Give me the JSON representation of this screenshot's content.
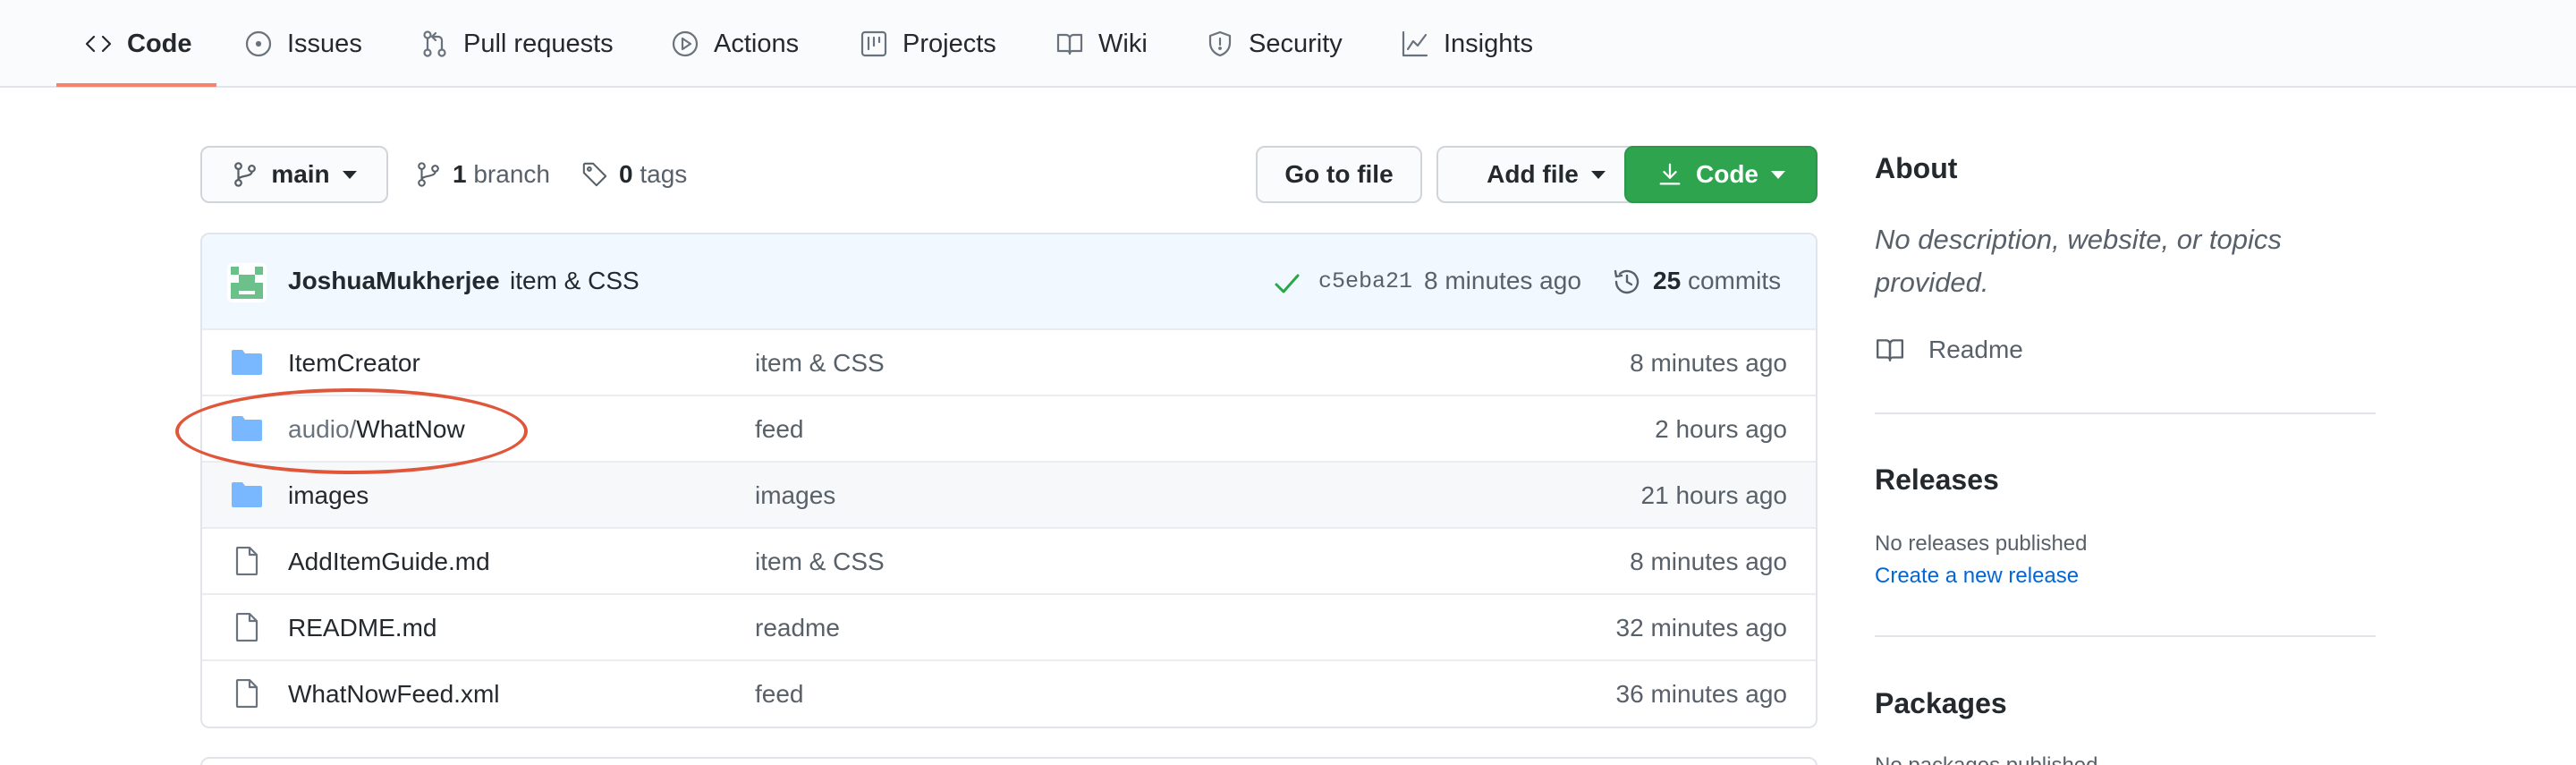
{
  "nav": {
    "tabs": [
      {
        "label": "Code",
        "icon": "code-icon",
        "selected": true
      },
      {
        "label": "Issues",
        "icon": "issue-opened-icon"
      },
      {
        "label": "Pull requests",
        "icon": "git-pull-request-icon"
      },
      {
        "label": "Actions",
        "icon": "play-icon"
      },
      {
        "label": "Projects",
        "icon": "project-icon"
      },
      {
        "label": "Wiki",
        "icon": "book-icon"
      },
      {
        "label": "Security",
        "icon": "shield-icon"
      },
      {
        "label": "Insights",
        "icon": "graph-icon"
      }
    ],
    "accent_color": "#f9826c"
  },
  "toolbar": {
    "branch_name": "main",
    "branch_count": "1",
    "branch_label": "branch",
    "tag_count": "0",
    "tag_label": "tags",
    "go_to_file": "Go to file",
    "add_file": "Add file",
    "code": "Code",
    "code_button_color": "#2ea44f"
  },
  "latest_commit": {
    "author": "JoshuaMukherjee",
    "message": "item & CSS",
    "sha": "c5eba21",
    "time": "8 minutes ago",
    "commit_count": "25",
    "commit_label": "commits",
    "status_color": "#28a745"
  },
  "files": [
    {
      "type": "dir",
      "name_prefix": "",
      "name": "ItemCreator",
      "message": "item & CSS",
      "age": "8 minutes ago"
    },
    {
      "type": "dir",
      "name_prefix": "audio/",
      "name": "WhatNow",
      "message": "feed",
      "age": "2 hours ago"
    },
    {
      "type": "dir",
      "name_prefix": "",
      "name": "images",
      "message": "images",
      "age": "21 hours ago"
    },
    {
      "type": "file",
      "name_prefix": "",
      "name": "AddItemGuide.md",
      "message": "item & CSS",
      "age": "8 minutes ago"
    },
    {
      "type": "file",
      "name_prefix": "",
      "name": "README.md",
      "message": "readme",
      "age": "32 minutes ago"
    },
    {
      "type": "file",
      "name_prefix": "",
      "name": "WhatNowFeed.xml",
      "message": "feed",
      "age": "36 minutes ago"
    }
  ],
  "annotation": {
    "color": "#e0563b"
  },
  "sidebar": {
    "about_title": "About",
    "about_desc": "No description, website, or topics provided.",
    "readme_label": "Readme",
    "releases_title": "Releases",
    "releases_text": "No releases published",
    "releases_link": "Create a new release",
    "packages_title": "Packages",
    "packages_text": "No packages published"
  }
}
